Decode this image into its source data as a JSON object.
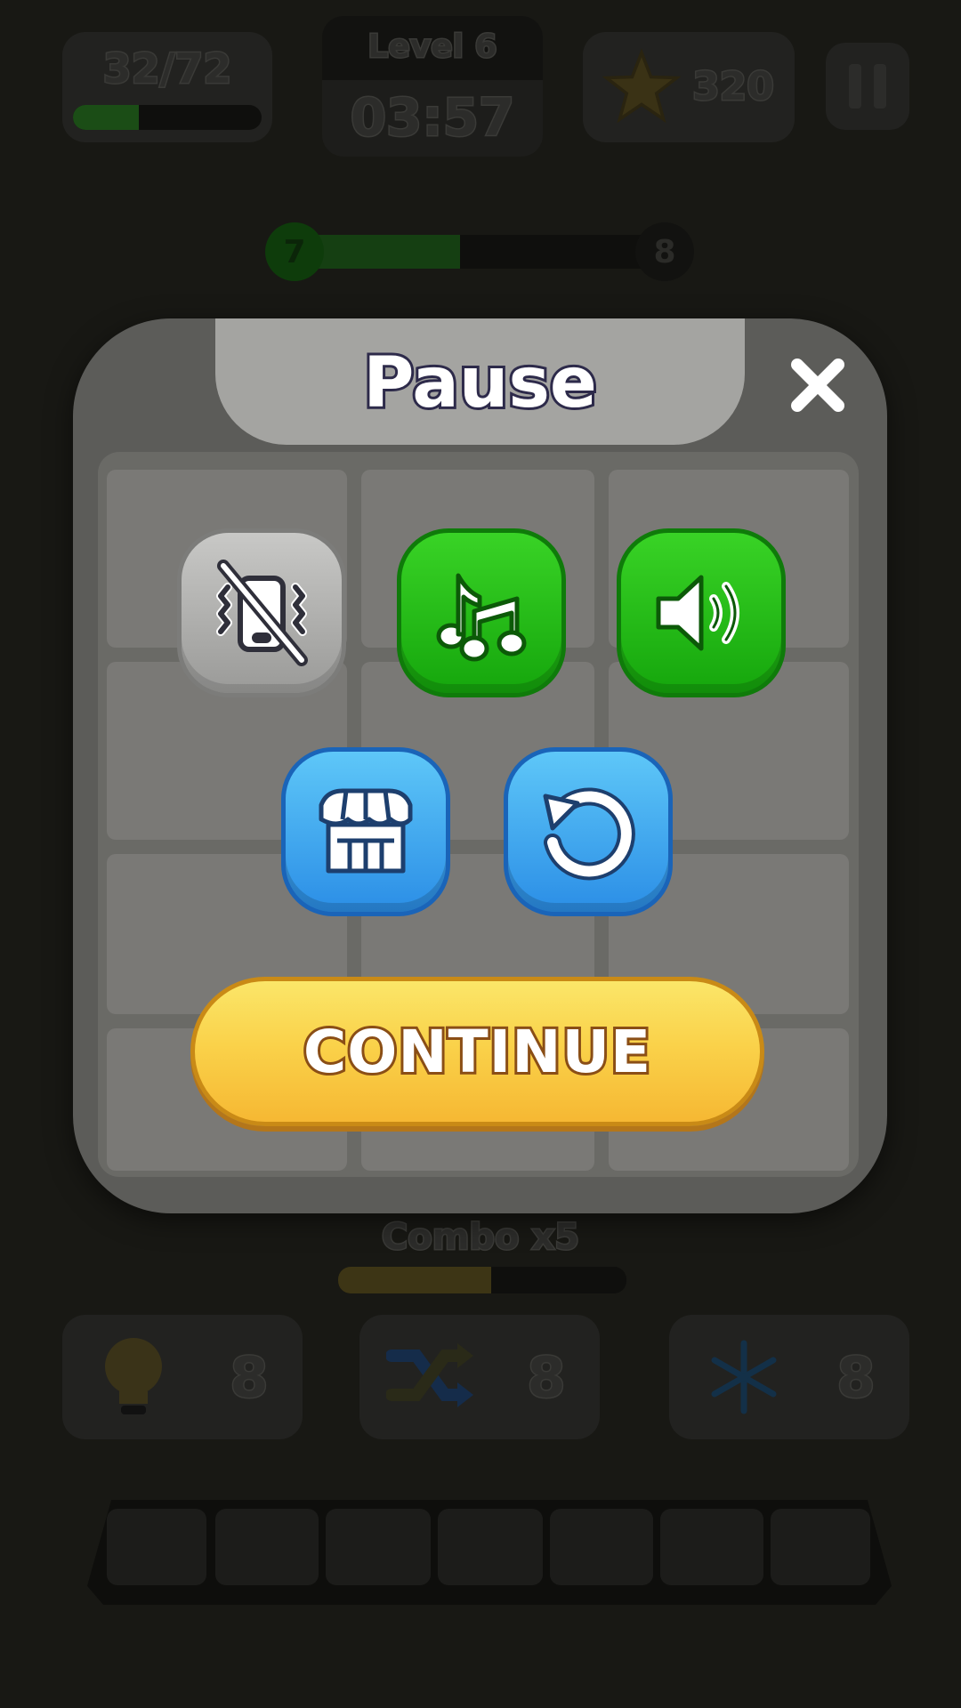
{
  "hud": {
    "items_count": "32/72",
    "items_progress": 0.35,
    "level_label": "Level 6",
    "timer": "03:57",
    "stars": "320"
  },
  "level_progress": {
    "current": "7",
    "next": "8",
    "fill": 0.45
  },
  "pause_modal": {
    "title": "Pause",
    "continue_label": "CONTINUE",
    "toggles": [
      {
        "name": "vibration",
        "icon": "vibration-off-icon",
        "state": "off"
      },
      {
        "name": "music",
        "icon": "music-note-icon",
        "state": "on"
      },
      {
        "name": "sound",
        "icon": "speaker-icon",
        "state": "on"
      }
    ],
    "actions": [
      {
        "name": "shop",
        "icon": "shop-icon"
      },
      {
        "name": "restart",
        "icon": "restart-icon"
      }
    ]
  },
  "combo": {
    "label": "Combo x5",
    "fill": 0.53
  },
  "boosters": [
    {
      "name": "hint",
      "icon": "lightbulb-icon",
      "count": "8"
    },
    {
      "name": "shuffle",
      "icon": "shuffle-icon",
      "count": "8"
    },
    {
      "name": "freeze",
      "icon": "snowflake-icon",
      "count": "8"
    }
  ],
  "colors": {
    "green_button": "#1db814",
    "blue_button": "#3aa6f0",
    "yellow_button": "#f9cc45",
    "gray_button": "#b0b0ae"
  }
}
